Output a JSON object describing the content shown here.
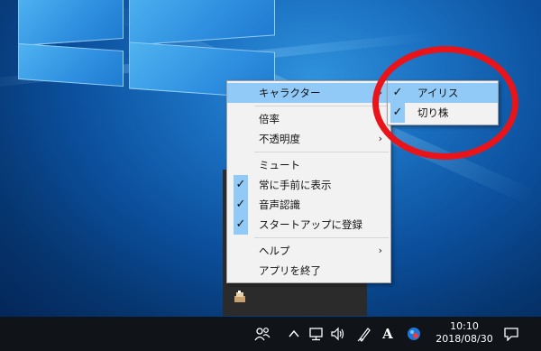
{
  "context_menu": {
    "items": [
      {
        "label": "キャラクター",
        "submenu": true,
        "highlighted": true
      },
      {
        "separator": true
      },
      {
        "label": "倍率"
      },
      {
        "label": "不透明度",
        "submenu": true
      },
      {
        "separator": true
      },
      {
        "label": "ミュート"
      },
      {
        "label": "常に手前に表示",
        "checked": true
      },
      {
        "label": "音声認識",
        "checked": true
      },
      {
        "label": "スタートアップに登録",
        "checked": true
      },
      {
        "separator": true
      },
      {
        "label": "ヘルプ",
        "submenu": true
      },
      {
        "label": "アプリを終了"
      }
    ],
    "submenu_arrow": "›",
    "check_glyph": "✓"
  },
  "character_submenu": {
    "items": [
      {
        "label": "アイリス",
        "checked": true,
        "highlighted": true
      },
      {
        "label": "切り株",
        "checked": true
      }
    ]
  },
  "taskbar": {
    "clock_time": "10:10",
    "clock_date": "2018/08/30",
    "ime_label": "A",
    "icons": [
      "people-icon",
      "chevron-up-icon",
      "network-icon",
      "volume-icon",
      "pen-icon",
      "ime-icon",
      "app-tray-icon",
      "notification-icon"
    ]
  },
  "colors": {
    "highlight": "#91c9f7",
    "annotation": "#e8141a",
    "taskbar": "#101418"
  }
}
